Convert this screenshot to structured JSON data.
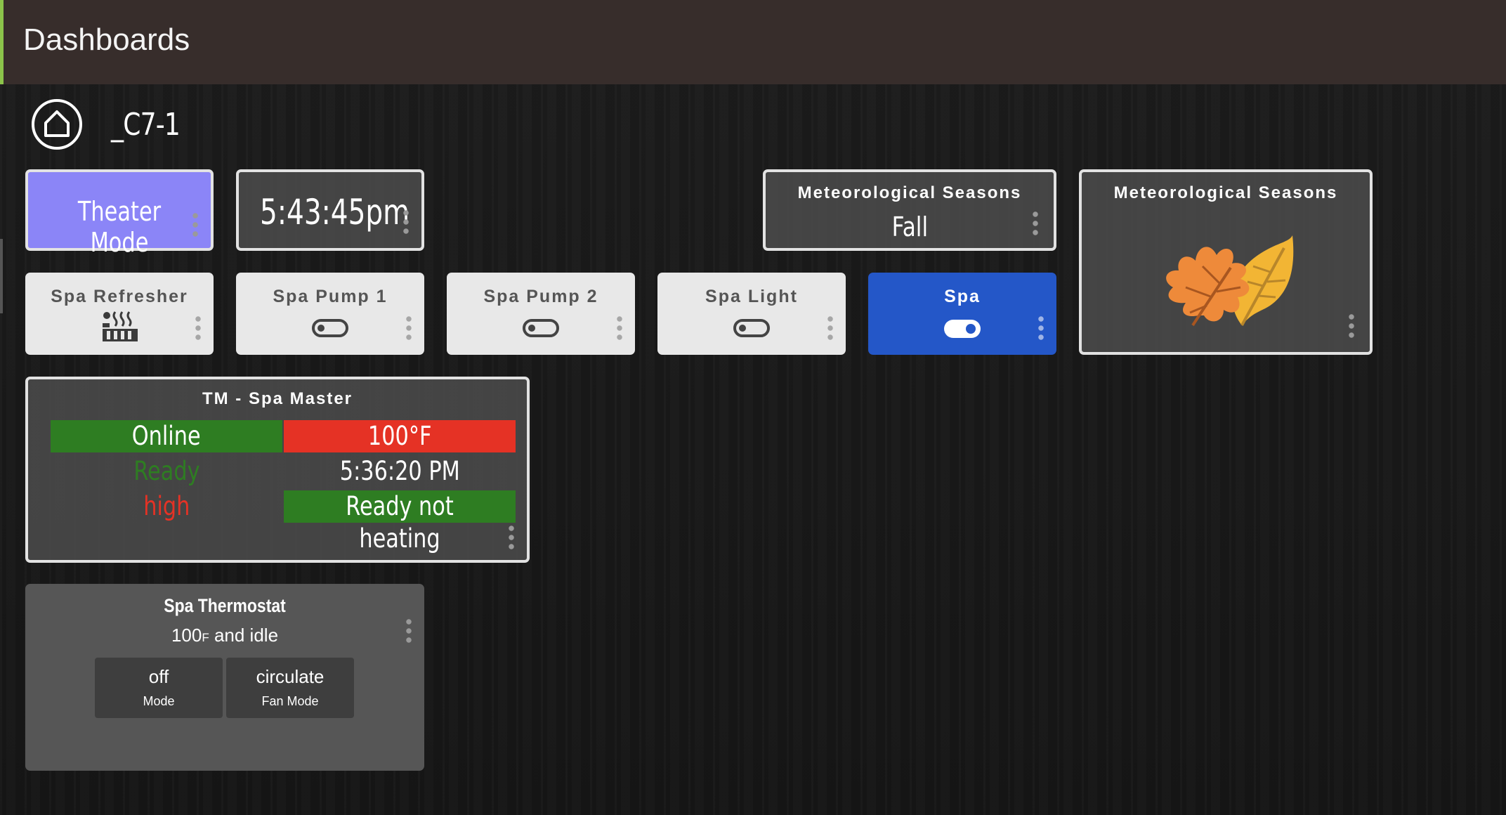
{
  "header": {
    "title": "Dashboards"
  },
  "hub": {
    "name": "_C7-1",
    "icon": "home-icon"
  },
  "tiles": {
    "theater_mode": {
      "label": "Theater Mode"
    },
    "clock": {
      "time": "5:43:45pm"
    },
    "season_text": {
      "title": "Meteorological Seasons",
      "value": "Fall"
    },
    "season_image": {
      "title": "Meteorological Seasons",
      "icon": "autumn-leaves-icon"
    },
    "spa_refresher": {
      "title": "Spa Refresher",
      "icon": "hot-tub-icon"
    },
    "spa_pump_1": {
      "title": "Spa Pump 1",
      "state": "off"
    },
    "spa_pump_2": {
      "title": "Spa Pump 2",
      "state": "off"
    },
    "spa_light": {
      "title": "Spa Light",
      "state": "off"
    },
    "spa": {
      "title": "Spa",
      "state": "on"
    },
    "spa_master": {
      "title": "TM - Spa Master",
      "status": "Online",
      "temperature": "100°F",
      "ready": "Ready",
      "time": "5:36:20 PM",
      "pump": "high",
      "heating": "Ready not heating"
    },
    "thermostat": {
      "title": "Spa Thermostat",
      "summary_temp": "100",
      "summary_unit": "F",
      "summary_state": " and idle",
      "mode_value": "off",
      "mode_label": "Mode",
      "fan_value": "circulate",
      "fan_label": "Fan Mode"
    }
  },
  "colors": {
    "header_bg": "#372d2b",
    "accent_green": "#8bc34a",
    "purple": "#8b85f7",
    "blue": "#2457c8",
    "online_green": "#2e7d22",
    "alert_red": "#e53225"
  }
}
